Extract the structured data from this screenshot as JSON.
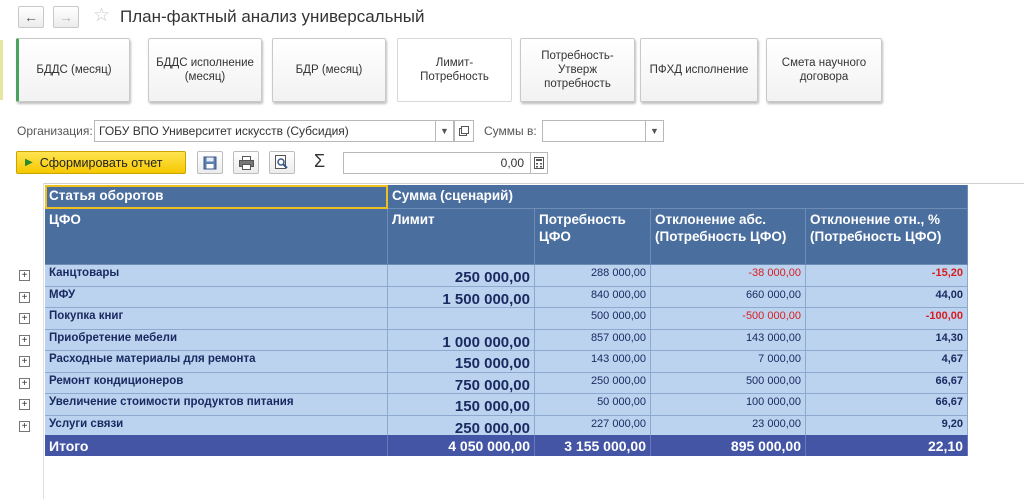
{
  "header": {
    "title": "План-фактный анализ универсальный",
    "back_icon": "arrow-left-icon",
    "forward_icon": "arrow-right-icon",
    "favorite_icon": "star-icon"
  },
  "report_tabs": [
    {
      "label": "БДДС (месяц)"
    },
    {
      "label": "БДДС исполнение\n(месяц)"
    },
    {
      "label": "БДР (месяц)"
    },
    {
      "label": "Лимит-Потребность"
    },
    {
      "label": "Потребность-Утверж\nпотребность"
    },
    {
      "label": "ПФХД исполнение"
    },
    {
      "label": "Смета научного\nдоговора"
    }
  ],
  "filters": {
    "org_label": "Организация:",
    "org_value": "ГОБУ ВПО Университет искусств (Субсидия)",
    "sums_label": "Суммы в:",
    "sums_value": ""
  },
  "toolbar": {
    "run_label": "Сформировать отчет",
    "sigma": "Σ",
    "sum_value": "0,00"
  },
  "table": {
    "header_group_left": "Статья оборотов",
    "header_group_right": "Сумма (сценарий)",
    "columns": [
      "ЦФО",
      "Лимит",
      "Потребность ЦФО",
      "Отклонение абс. (Потребность ЦФО)",
      "Отклонение отн., % (Потребность ЦФО)"
    ],
    "rows": [
      {
        "name": "Канцтовары",
        "limit": "250 000,00",
        "need": "288 000,00",
        "dev_abs": "-38 000,00",
        "dev_rel": "-15,20"
      },
      {
        "name": "МФУ",
        "limit": "1 500 000,00",
        "need": "840 000,00",
        "dev_abs": "660 000,00",
        "dev_rel": "44,00"
      },
      {
        "name": "Покупка книг",
        "limit": "",
        "need": "500 000,00",
        "dev_abs": "-500 000,00",
        "dev_rel": "-100,00"
      },
      {
        "name": "Приобретение мебели",
        "limit": "1 000 000,00",
        "need": "857 000,00",
        "dev_abs": "143 000,00",
        "dev_rel": "14,30"
      },
      {
        "name": "Расходные материалы для ремонта",
        "limit": "150 000,00",
        "need": "143 000,00",
        "dev_abs": "7 000,00",
        "dev_rel": "4,67"
      },
      {
        "name": "Ремонт кондиционеров",
        "limit": "750 000,00",
        "need": "250 000,00",
        "dev_abs": "500 000,00",
        "dev_rel": "66,67"
      },
      {
        "name": "Увеличение стоимости продуктов питания",
        "limit": "150 000,00",
        "need": "50 000,00",
        "dev_abs": "100 000,00",
        "dev_rel": "66,67"
      },
      {
        "name": "Услуги связи",
        "limit": "250 000,00",
        "need": "227 000,00",
        "dev_abs": "23 000,00",
        "dev_rel": "9,20"
      }
    ],
    "total": {
      "name": "Итого",
      "limit": "4 050 000,00",
      "need": "3 155 000,00",
      "dev_abs": "895 000,00",
      "dev_rel": "22,10"
    }
  },
  "colors": {
    "header_bg": "#4a6e9e",
    "row_bg": "#bcd3f0",
    "total_bg": "#4455a6",
    "negative": "#d81e1e",
    "run_button": "#f5c800"
  }
}
